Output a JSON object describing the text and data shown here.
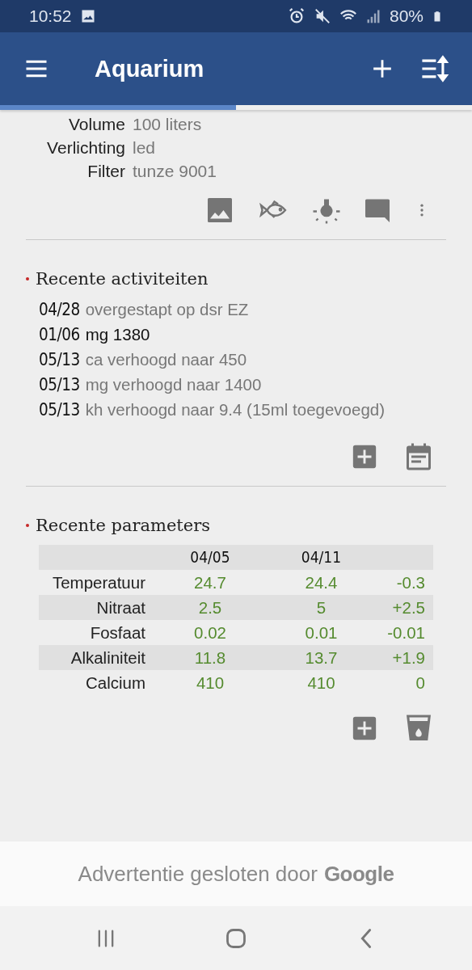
{
  "status_bar": {
    "time": "10:52",
    "battery": "80%"
  },
  "app_bar": {
    "title": "Aquarium"
  },
  "progress": {
    "level": 0.5
  },
  "info": [
    {
      "label": "Volume",
      "value": "100 liters"
    },
    {
      "label": "Verlichting",
      "value": "led"
    },
    {
      "label": "Filter",
      "value": "tunze 9001"
    }
  ],
  "activities": {
    "title": "Recente activiteiten",
    "items": [
      {
        "date": "04/28",
        "text": "overgestapt op dsr EZ",
        "highlighted": false
      },
      {
        "date": "01/06",
        "text": "mg 1380",
        "highlighted": true
      },
      {
        "date": "05/13",
        "text": "ca verhoogd naar 450",
        "highlighted": false
      },
      {
        "date": "05/13",
        "text": "mg verhoogd naar 1400",
        "highlighted": false
      },
      {
        "date": "05/13",
        "text": "kh verhoogd naar 9.4 (15ml toegevoegd)",
        "highlighted": false
      }
    ]
  },
  "parameters": {
    "title": "Recente parameters",
    "columns": [
      "04/05",
      "04/11"
    ],
    "rows": [
      {
        "name": "Temperatuur",
        "values": [
          "24.7",
          "24.4"
        ],
        "change": "-0.3"
      },
      {
        "name": "Nitraat",
        "values": [
          "2.5",
          "5"
        ],
        "change": "+2.5"
      },
      {
        "name": "Fosfaat",
        "values": [
          "0.02",
          "0.01"
        ],
        "change": "-0.01"
      },
      {
        "name": "Alkaliniteit",
        "values": [
          "11.8",
          "13.7"
        ],
        "change": "+1.9"
      },
      {
        "name": "Calcium",
        "values": [
          "410",
          "410"
        ],
        "change": "0"
      }
    ]
  },
  "ad": {
    "text": "Advertentie gesloten door",
    "brand": "Google"
  }
}
